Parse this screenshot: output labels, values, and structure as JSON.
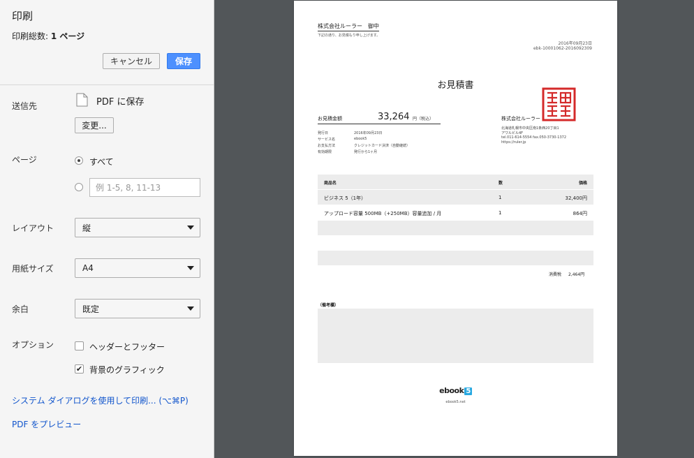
{
  "sidebar": {
    "title": "印刷",
    "page_count_label": "印刷総数: ",
    "page_count_value": "1 ページ",
    "cancel_label": "キャンセル",
    "save_label": "保存",
    "destination": {
      "label": "送信先",
      "value": "PDF に保存",
      "change_label": "変更...",
      "icon": "pdf-file-icon"
    },
    "pages": {
      "label": "ページ",
      "all_label": "すべて",
      "custom_placeholder": "例 1-5, 8, 11-13",
      "selected": "all"
    },
    "layout": {
      "label": "レイアウト",
      "value": "縦"
    },
    "paper": {
      "label": "用紙サイズ",
      "value": "A4"
    },
    "margins": {
      "label": "余白",
      "value": "既定"
    },
    "options": {
      "label": "オプション",
      "header_footer_label": "ヘッダーとフッター",
      "header_footer_checked": false,
      "background_label": "背景のグラフィック",
      "background_checked": true
    },
    "system_dialog_link": "システム ダイアログを使用して印刷... (⌥⌘P)",
    "pdf_preview_link": "PDF をプレビュー"
  },
  "document": {
    "addressee": "株式会社ルーラー　御中",
    "note": "下記の通り、お見積もり申し上げます。",
    "date": "2016年09月23日",
    "doc_number": "ebk-10001062-2016092309",
    "title": "お見積書",
    "total_label": "お見積金額",
    "total_value": "33,264",
    "total_unit": "円（税込）",
    "info": [
      {
        "label": "発行日",
        "value": "2016年09月23日"
      },
      {
        "label": "サービス名",
        "value": "ebook5"
      },
      {
        "label": "お支払方法",
        "value": "クレジットカード決済（自動継続）"
      },
      {
        "label": "有効期限",
        "value": "発行から1ヶ月"
      }
    ],
    "company_name": "株式会社ルーラー",
    "company_address": [
      "北海道札幌市中央区南1条西20丁目1",
      "アワルビル4F",
      "tel.011-614-5554 fax.050-3730-1372",
      "https://ruler.jp"
    ],
    "seal_icon": "company-seal-icon",
    "seal_color": "#d42a2a",
    "table_headers": {
      "name": "商品名",
      "qty": "数",
      "price": "価格"
    },
    "rows": [
      {
        "name": "ビジネス 5（1年）",
        "qty": "1",
        "price": "32,400円"
      },
      {
        "name": "アップロード容量 500MB（+250MB）容量追加 / 月",
        "qty": "1",
        "price": "864円"
      },
      {
        "name": "",
        "qty": "",
        "price": ""
      },
      {
        "name": "",
        "qty": "",
        "price": ""
      },
      {
        "name": "",
        "qty": "",
        "price": ""
      }
    ],
    "tax_label": "消費税",
    "tax_value": "2,464円",
    "remarks_label": "（備考欄）",
    "logo_text": "ebook",
    "logo_mark": "5",
    "logo_url": "ebook5.net"
  }
}
